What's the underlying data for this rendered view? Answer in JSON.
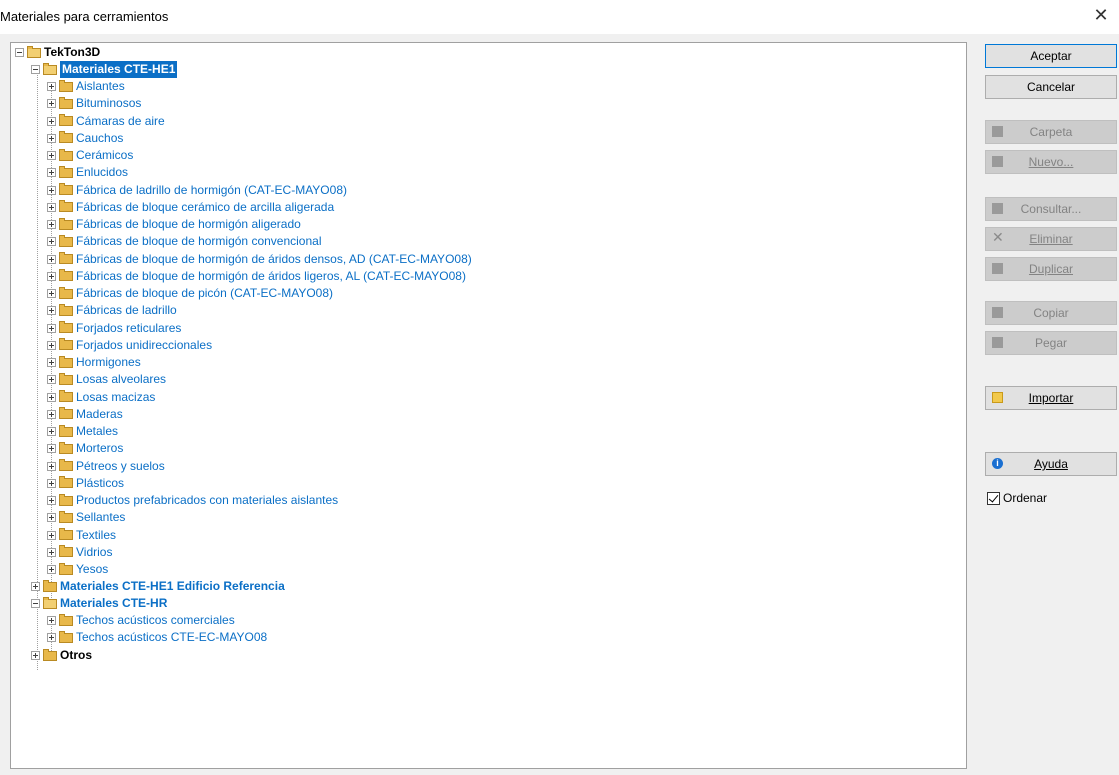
{
  "window": {
    "title": "Materiales para cerramientos",
    "close_glyph": "✕"
  },
  "tree": {
    "root": "TekTon3D",
    "group1": "Materiales CTE-HE1",
    "group1_items": [
      "Aislantes",
      "Bituminosos",
      "Cámaras de aire",
      "Cauchos",
      "Cerámicos",
      "Enlucidos",
      "Fábrica de ladrillo de hormigón (CAT-EC-MAYO08)",
      "Fábricas de bloque cerámico de arcilla aligerada",
      "Fábricas de bloque de hormigón aligerado",
      "Fábricas de bloque de hormigón convencional",
      "Fábricas de bloque de hormigón de áridos densos, AD (CAT-EC-MAYO08)",
      "Fábricas de bloque de hormigón de áridos ligeros, AL (CAT-EC-MAYO08)",
      "Fábricas de bloque de picón (CAT-EC-MAYO08)",
      "Fábricas de ladrillo",
      "Forjados reticulares",
      "Forjados unidireccionales",
      "Hormigones",
      "Losas alveolares",
      "Losas macizas",
      "Maderas",
      "Metales",
      "Morteros",
      "Pétreos y suelos",
      "Plásticos",
      "Productos prefabricados con materiales aislantes",
      "Sellantes",
      "Textiles",
      "Vidrios",
      "Yesos"
    ],
    "group2": "Materiales CTE-HE1 Edificio Referencia",
    "group3": "Materiales CTE-HR",
    "group3_items": [
      "Techos acústicos comerciales",
      "Techos acústicos CTE-EC-MAYO08"
    ],
    "group4": "Otros"
  },
  "buttons": {
    "aceptar": "Aceptar",
    "cancelar": "Cancelar",
    "carpeta": "Carpeta",
    "nuevo": "Nuevo...",
    "consultar": "Consultar...",
    "eliminar": "Eliminar",
    "duplicar": "Duplicar",
    "copiar": "Copiar",
    "pegar": "Pegar",
    "importar": "Importar",
    "ayuda": "Ayuda"
  },
  "options": {
    "ordenar": "Ordenar",
    "ordenar_checked": true
  },
  "colors": {
    "link_blue": "#0b6fc6",
    "selection": "#0b6fc6",
    "folder": "#e8b84a"
  }
}
